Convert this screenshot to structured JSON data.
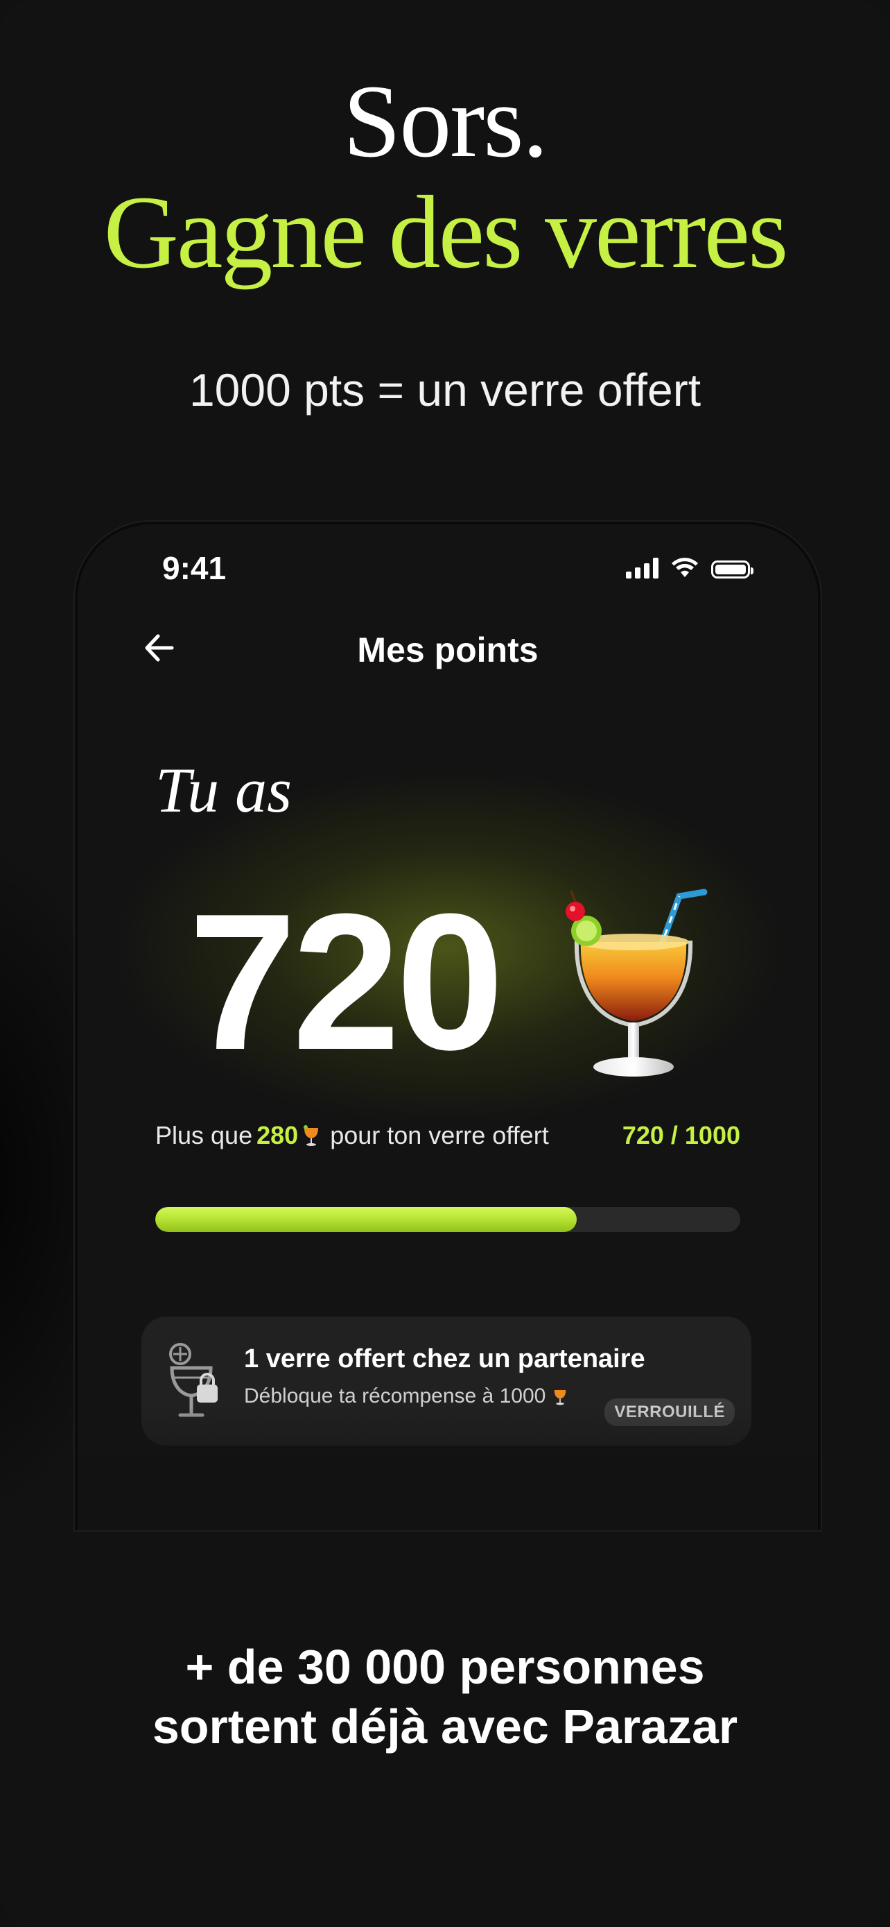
{
  "hero": {
    "line1": "Sors.",
    "line2": "Gagne des verres",
    "subtitle": "1000 pts = un verre offert"
  },
  "status_bar": {
    "time": "9:41",
    "icons": [
      "signal-icon",
      "wifi-icon",
      "battery-icon"
    ]
  },
  "nav": {
    "back_icon": "arrow-left-icon",
    "title": "Mes points"
  },
  "points": {
    "intro": "Tu as",
    "value": "720",
    "icon": "cocktail-icon"
  },
  "progress": {
    "prefix": "Plus que",
    "remaining": "280",
    "suffix": "pour ton verre offert",
    "count": "720 / 1000",
    "fraction": 0.72
  },
  "reward": {
    "title": "1 verre offert chez un partenaire",
    "subtitle": "Débloque ta récompense à 1000",
    "badge": "VERROUILLÉ",
    "icon": "locked-glass-icon"
  },
  "footer": {
    "line1": "+ de 30 000 personnes",
    "line2": "sortent déjà avec Parazar"
  },
  "colors": {
    "accent": "#c6f043",
    "background": "#121212",
    "card": "#212121"
  }
}
